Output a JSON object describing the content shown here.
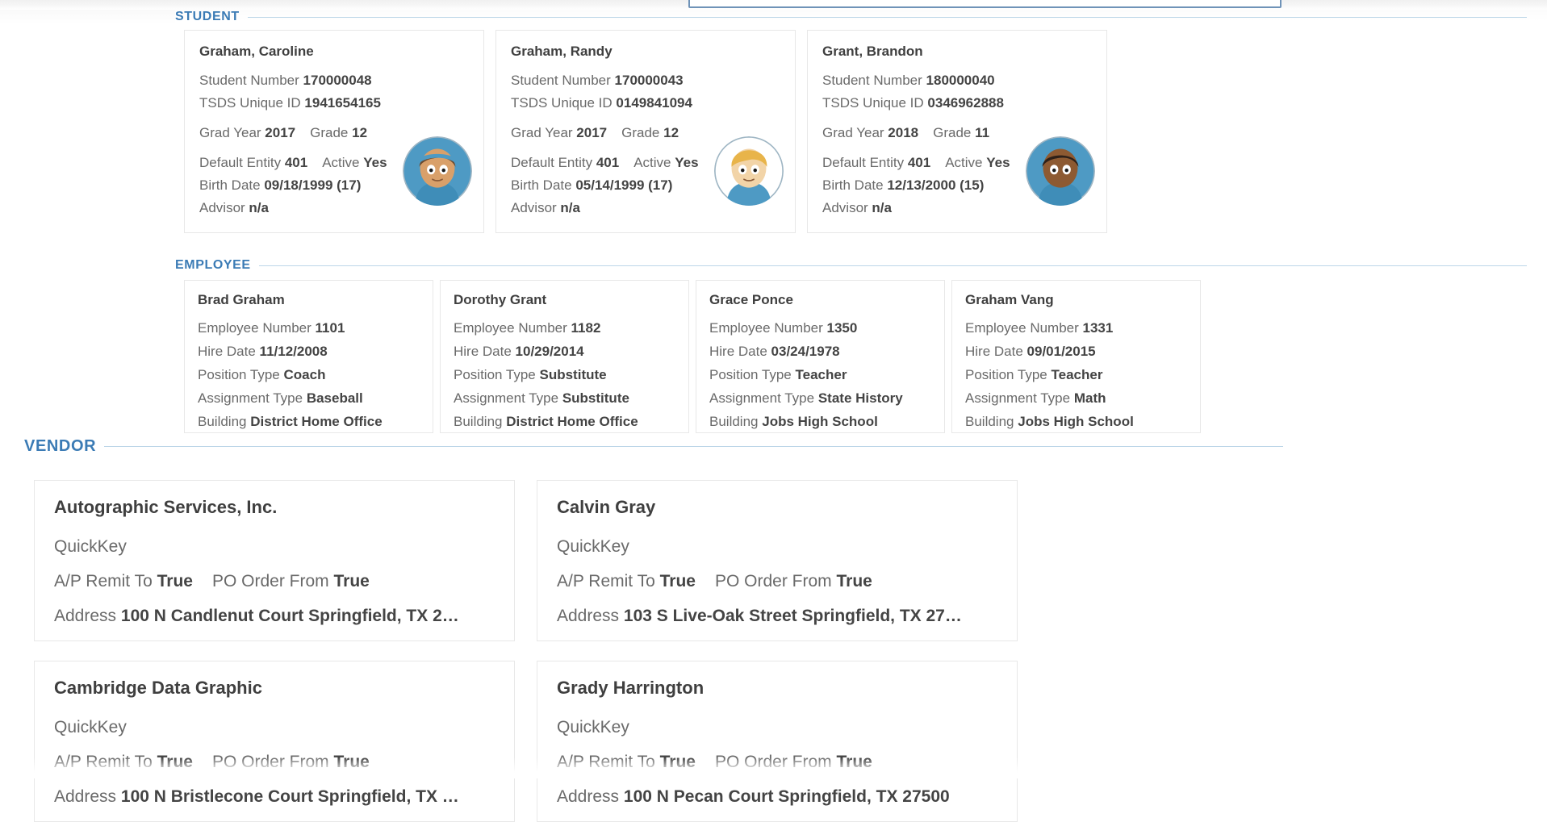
{
  "colors": {
    "section_heading": "#3b7bb5",
    "rule": "#bcd6e8",
    "label_text": "#6a6a6a",
    "value_text": "#444444",
    "card_border": "#e8e8e8",
    "field_border": "#6f93b8"
  },
  "sections": {
    "student": {
      "title": "STUDENT"
    },
    "employee": {
      "title": "EMPLOYEE"
    },
    "vendor": {
      "title": "VENDOR"
    }
  },
  "field_labels": {
    "student_number": "Student Number",
    "tsds_unique_id": "TSDS Unique ID",
    "grad_year": "Grad Year",
    "grade": "Grade",
    "default_entity": "Default Entity",
    "active": "Active",
    "birth_date": "Birth Date",
    "advisor": "Advisor",
    "employee_number": "Employee Number",
    "hire_date": "Hire Date",
    "position_type": "Position Type",
    "assignment_type": "Assignment Type",
    "building": "Building",
    "quickkey": "QuickKey",
    "ap_remit_to": "A/P Remit To",
    "po_order_from": "PO Order From",
    "address": "Address"
  },
  "students": [
    {
      "name": "Graham, Caroline",
      "student_number": "170000048",
      "tsds_unique_id": "1941654165",
      "grad_year": "2017",
      "grade": "12",
      "default_entity": "401",
      "active": "Yes",
      "birth_date": "09/18/1999 (17)",
      "advisor": "n/a",
      "avatar": "avatar-girl-blue-headband"
    },
    {
      "name": "Graham, Randy",
      "student_number": "170000043",
      "tsds_unique_id": "0149841094",
      "grad_year": "2017",
      "grade": "12",
      "default_entity": "401",
      "active": "Yes",
      "birth_date": "05/14/1999 (17)",
      "advisor": "n/a",
      "avatar": "avatar-boy-blond"
    },
    {
      "name": "Grant, Brandon",
      "student_number": "180000040",
      "tsds_unique_id": "0346962888",
      "grad_year": "2018",
      "grade": "11",
      "default_entity": "401",
      "active": "Yes",
      "birth_date": "12/13/2000 (15)",
      "advisor": "n/a",
      "avatar": "avatar-boy-dark-hair"
    }
  ],
  "employees": [
    {
      "name": "Brad Graham",
      "employee_number": "1101",
      "hire_date": "11/12/2008",
      "position_type": "Coach",
      "assignment_type": "Baseball",
      "building": "District Home Office"
    },
    {
      "name": "Dorothy Grant",
      "employee_number": "1182",
      "hire_date": "10/29/2014",
      "position_type": "Substitute",
      "assignment_type": "Substitute",
      "building": "District Home Office"
    },
    {
      "name": "Grace Ponce",
      "employee_number": "1350",
      "hire_date": "03/24/1978",
      "position_type": "Teacher",
      "assignment_type": "State History",
      "building": "Jobs High School"
    },
    {
      "name": "Graham Vang",
      "employee_number": "1331",
      "hire_date": "09/01/2015",
      "position_type": "Teacher",
      "assignment_type": "Math",
      "building": "Jobs High School"
    }
  ],
  "vendors": [
    {
      "name": "Autographic Services, Inc.",
      "quickkey": "QuickKey",
      "ap_remit_to": "True",
      "po_order_from": "True",
      "address": "100 N Candlenut Court Springfield, TX 2…"
    },
    {
      "name": "Calvin Gray",
      "quickkey": "QuickKey",
      "ap_remit_to": "True",
      "po_order_from": "True",
      "address": "103 S Live-Oak Street Springfield, TX 27…"
    },
    {
      "name": "Cambridge Data Graphic",
      "quickkey": "QuickKey",
      "ap_remit_to": "True",
      "po_order_from": "True",
      "address": "100 N Bristlecone Court Springfield, TX …"
    },
    {
      "name": "Grady Harrington",
      "quickkey": "QuickKey",
      "ap_remit_to": "True",
      "po_order_from": "True",
      "address": "100 N Pecan Court Springfield, TX 27500"
    }
  ]
}
